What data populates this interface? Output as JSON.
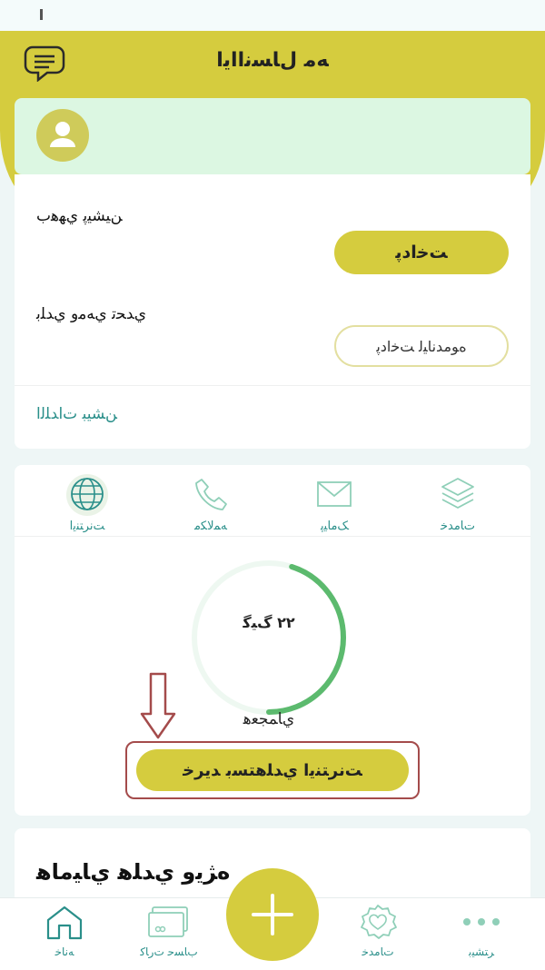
{
  "header": {
    "title": "ﻪﻣ ﻝﺎﺴﻧﺍﺍﻳﺍ"
  },
  "account": {
    "balance_label": "ﻦﻴﺸﻴﭘ ﻱﻬﻫﺏ",
    "pay_button": "ﺖﺧﺍﺩﭘ",
    "debt_label": "ﻱﺪﺤﺗ ﻱﻪﻣﻭ ﻱﺪﻠﺑ",
    "auto_pay_button": "ﻩﻮﻣﺪﻧﺎﻴﻟ ﺖﺧﺍﺩﭘ",
    "history_link": "ﻦﺸﻴﺒ ﺕﺍﺪﻠﻟﺍ"
  },
  "service_tabs": [
    {
      "label": "ﺖﻧﺮﺘﻨﯾﺍ",
      "icon": "globe-icon",
      "active": true
    },
    {
      "label": "ﻪﻤﻟﺎﮑﻣ",
      "icon": "phone-icon",
      "active": false
    },
    {
      "label": "ﮏﻣﺎﻴﭘ",
      "icon": "mail-icon",
      "active": false
    },
    {
      "label": "ﺕﺎﻣﺪﺧ",
      "icon": "layers-icon",
      "active": false
    }
  ],
  "usage": {
    "value_text": "۲۲ ﮒﯿﮔ",
    "caption": "ﻱﺎﻤﺠﻌﻫ",
    "fill_fraction": 0.45,
    "buy_button": "ﺖﻧﺮﺘﻨﯾﺍ ﻱﺪﻠﻫﺘﺴﺑ ﺪﻳﺮﺧ"
  },
  "offers": {
    "title": "ﻩﮋﻳﻭ ﻱﺪﻠﻫ ﻱﺎﻴﻣﺎﻫ"
  },
  "bottom_nav": [
    {
      "label": "ﻪﻧﺎﺧ",
      "icon": "home-icon",
      "active": true
    },
    {
      "label": "ﺏﺎﺴﺣ ﺕﺭﺎﮐ",
      "icon": "card-icon",
      "active": false
    },
    {
      "label": "ﺕﺎﻣﺪﺧ",
      "icon": "badge-icon",
      "active": false
    },
    {
      "label": "ﺮﺘﺸﻴﺑ",
      "icon": "more-icon",
      "active": false
    }
  ],
  "colors": {
    "accent": "#d5cc3e",
    "teal": "#2a8f8a",
    "gauge": "#5cba6e",
    "highlight": "#a44b4b"
  }
}
